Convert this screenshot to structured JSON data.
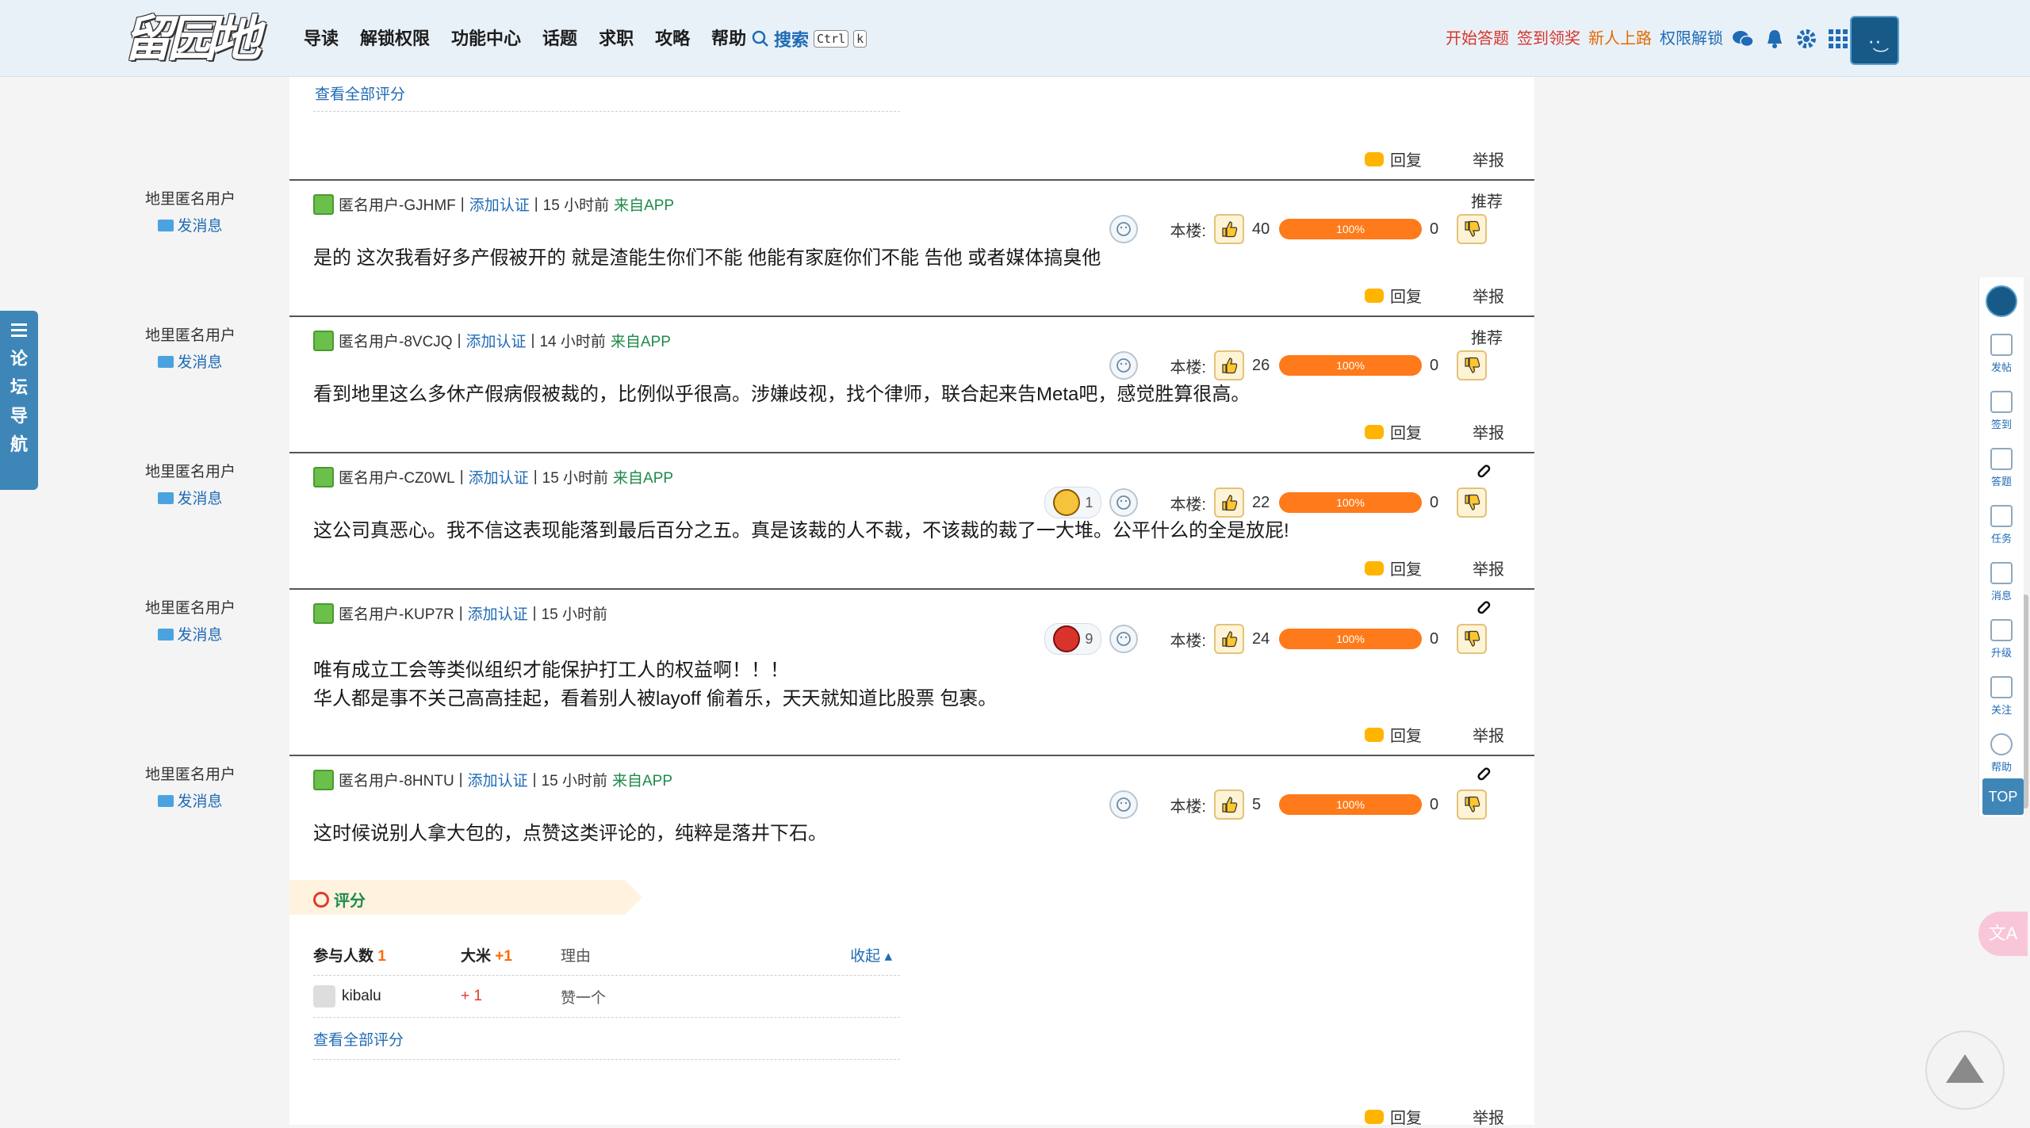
{
  "header": {
    "logo_text": "留园地",
    "nav": [
      "导读",
      "解锁权限",
      "功能中心",
      "话题",
      "求职",
      "攻略",
      "帮助"
    ],
    "search_label": "搜索",
    "kbd_ctrl": "Ctrl",
    "kbd_k": "k",
    "links": {
      "start_answer": "开始答题",
      "checkin_reward": "签到领奖",
      "new_user": "新人上路",
      "unlock_permissions": "权限解锁"
    }
  },
  "prev_rating": {
    "view_all": "查看全部评分"
  },
  "common": {
    "side_user": "地里匿名用户",
    "send_message": "发消息",
    "add_cert": "添加认证",
    "reply": "回复",
    "report": "举报",
    "recommend": "推荐",
    "floor_label": "本楼:",
    "percent": "100%",
    "from_app": "来自APP"
  },
  "posts": [
    {
      "user": "匿名用户-GJHMF",
      "time": "15 小时前",
      "from_app": true,
      "tag": "推荐",
      "likes": "40",
      "dislikes": "0",
      "reaction": null,
      "body": [
        "是的 这次我看好多产假被开的 就是渣能生你们不能 他能有家庭你们不能 告他 或者媒体搞臭他"
      ]
    },
    {
      "user": "匿名用户-8VCJQ",
      "time": "14 小时前",
      "from_app": true,
      "tag": "推荐",
      "likes": "26",
      "dislikes": "0",
      "reaction": null,
      "body": [
        "看到地里这么多休产假病假被裁的，比例似乎很高。涉嫌歧视，找个律师，联合起来告Meta吧，感觉胜算很高。"
      ]
    },
    {
      "user": "匿名用户-CZ0WL",
      "time": "15 小时前",
      "from_app": true,
      "tag": "pin",
      "likes": "22",
      "dislikes": "0",
      "reaction": {
        "count": "1",
        "type": "smile"
      },
      "body": [
        "这公司真恶心。我不信这表现能落到最后百分之五。真是该裁的人不裁，不该裁的裁了一大堆。公平什么的全是放屁!"
      ]
    },
    {
      "user": "匿名用户-KUP7R",
      "time": "15 小时前",
      "from_app": false,
      "tag": "pin",
      "likes": "24",
      "dislikes": "0",
      "reaction": {
        "count": "9",
        "type": "100"
      },
      "body": [
        "唯有成立工会等类似组织才能保护打工人的权益啊！！！",
        "华人都是事不关己高高挂起，看着别人被layoff 偷着乐，天天就知道比股票 包裹。"
      ]
    },
    {
      "user": "匿名用户-8HNTU",
      "time": "15 小时前",
      "from_app": true,
      "tag": "pin",
      "likes": "5",
      "dislikes": "0",
      "reaction": null,
      "body": [
        "这时候说别人拿大包的，点赞这类评论的，纯粹是落井下石。"
      ]
    }
  ],
  "rating": {
    "title": "评分",
    "col_participants": "参与人数",
    "participants_count": "1",
    "col_rice": "大米",
    "rice_total": "+1",
    "col_reason": "理由",
    "collapse": "收起",
    "rows": [
      {
        "user": "kibalu",
        "rice": "+ 1",
        "reason": "赞一个"
      }
    ],
    "view_all": "查看全部评分"
  },
  "left_nav": {
    "label_chars": [
      "论",
      "坛",
      "导",
      "航"
    ]
  },
  "right_tools": [
    "发帖",
    "签到",
    "答题",
    "任务",
    "消息",
    "升级",
    "关注",
    "帮助"
  ],
  "top_button": "TOP",
  "translate_label": "文A"
}
